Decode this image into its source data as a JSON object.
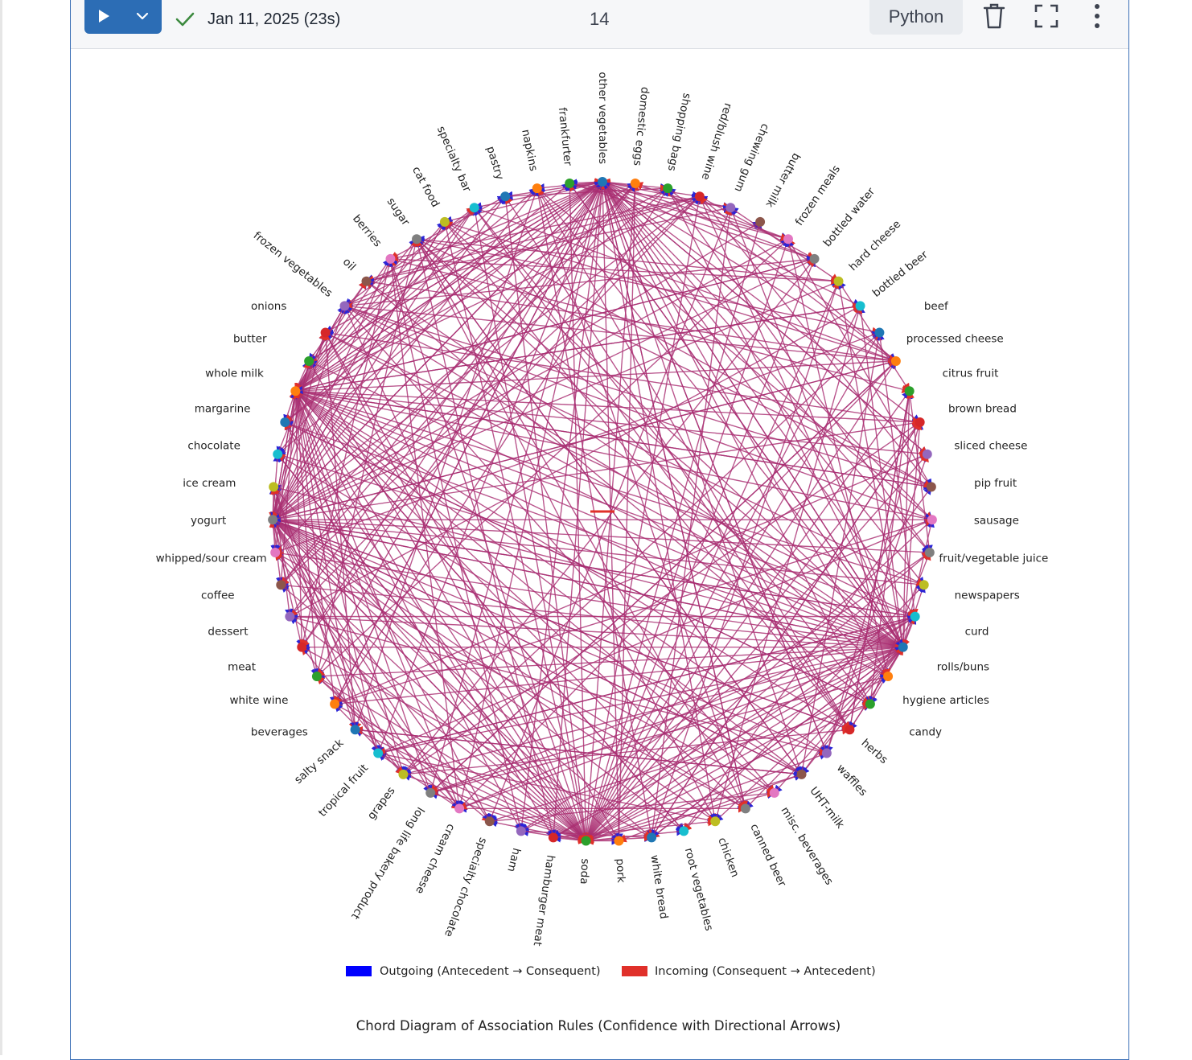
{
  "toolbar": {
    "run_label": "Run cell",
    "run_menu_label": "Run options",
    "status": "Jan 11, 2025 (23s)",
    "cell_number": "14",
    "language": "Python",
    "delete_label": "Delete",
    "fullscreen_label": "Fullscreen",
    "more_label": "More actions"
  },
  "colors": {
    "run_button": "#2c6db5",
    "success_check": "#3c8a3f",
    "outgoing": "#0000ff",
    "incoming": "#e0302a",
    "chord_blend": "#b5305a"
  },
  "chart_data": {
    "type": "chord",
    "title": "Chord Diagram of Association Rules (Confidence with Directional Arrows)",
    "legend": [
      {
        "label": "Outgoing (Antecedent → Consequent)",
        "color": "#0000ff"
      },
      {
        "label": "Incoming (Consequent → Antecedent)",
        "color": "#e0302a"
      }
    ],
    "legend_position": "bottom-center",
    "hubs": [
      "other vegetables",
      "whole milk",
      "yogurt",
      "rolls/buns",
      "soda"
    ],
    "nodes": [
      "other vegetables",
      "domestic eggs",
      "shopping bags",
      "red/blush wine",
      "chewing gum",
      "butter milk",
      "frozen meals",
      "bottled water",
      "hard cheese",
      "bottled beer",
      "beef",
      "processed cheese",
      "citrus fruit",
      "brown bread",
      "sliced cheese",
      "pip fruit",
      "sausage",
      "fruit/vegetable juice",
      "newspapers",
      "curd",
      "rolls/buns",
      "hygiene articles",
      "candy",
      "herbs",
      "waffles",
      "UHT-milk",
      "misc. beverages",
      "canned beer",
      "chicken",
      "root vegetables",
      "white bread",
      "pork",
      "soda",
      "hamburger meat",
      "ham",
      "specialty chocolate",
      "cream cheese",
      "long life bakery product",
      "grapes",
      "tropical fruit",
      "salty snack",
      "beverages",
      "white wine",
      "meat",
      "dessert",
      "coffee",
      "whipped/sour cream",
      "yogurt",
      "ice cream",
      "chocolate",
      "margarine",
      "whole milk",
      "butter",
      "onions",
      "frozen vegetables",
      "oil",
      "berries",
      "sugar",
      "cat food",
      "specialty bar",
      "pastry",
      "napkins",
      "frankfurter"
    ],
    "node_colors": [
      "#1f77b4",
      "#ff7f0e",
      "#2ca02c",
      "#d62728",
      "#9467bd",
      "#8c564b",
      "#e377c2",
      "#7f7f7f",
      "#bcbd22",
      "#17becf"
    ]
  }
}
